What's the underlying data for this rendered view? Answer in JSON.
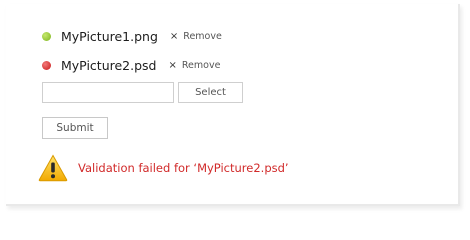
{
  "files": [
    {
      "name": "MyPicture1.png",
      "status": "valid",
      "remove_label": "Remove",
      "remove_icon": "×"
    },
    {
      "name": "MyPicture2.psd",
      "status": "invalid",
      "remove_label": "Remove",
      "remove_icon": "×"
    }
  ],
  "upload": {
    "input_value": "",
    "select_label": "Select",
    "submit_label": "Submit"
  },
  "validation": {
    "message": "Validation failed for ‘MyPicture2.psd’",
    "icon": "warning-icon"
  },
  "colors": {
    "valid_dot": "#8cc23a",
    "invalid_dot": "#d42020",
    "error_text": "#d12a2a",
    "warning_icon": "#f5b400"
  }
}
